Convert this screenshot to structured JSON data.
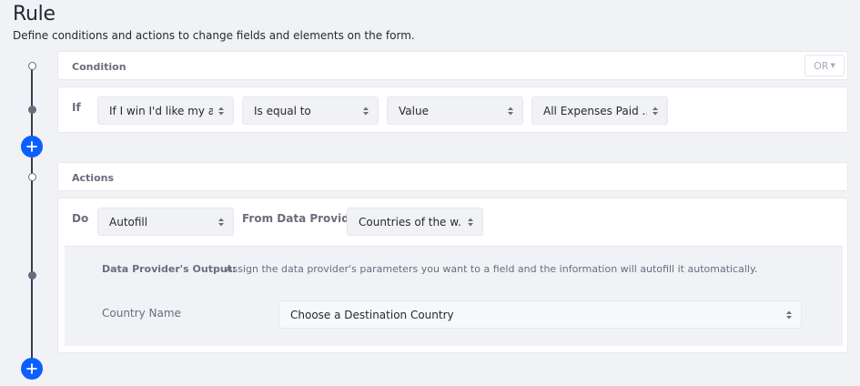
{
  "page": {
    "title": "Rule",
    "description": "Define conditions and actions to change fields and elements on the form."
  },
  "condition": {
    "header": "Condition",
    "or_label": "OR",
    "if_label": "If",
    "first_operand": "If I win I'd like my a...",
    "operator": "Is equal to",
    "second_operand_type": "Value",
    "second_operand": "All Expenses Paid ..."
  },
  "actions": {
    "header": "Actions",
    "do_label": "Do",
    "action": "Autofill",
    "from_label": "From Data Provider",
    "data_provider": "Countries of the w...",
    "output_label": "Data Provider's Output:",
    "output_desc": "Assign the data provider's parameters you want to a field and the information will autofill it automatically.",
    "param_label": "Country Name",
    "param_target": "Choose a Destination Country"
  },
  "colors": {
    "accent": "#0b5fff",
    "background": "#f1f2f5",
    "panel": "#ffffff",
    "muted_text": "#6b6c7e"
  }
}
